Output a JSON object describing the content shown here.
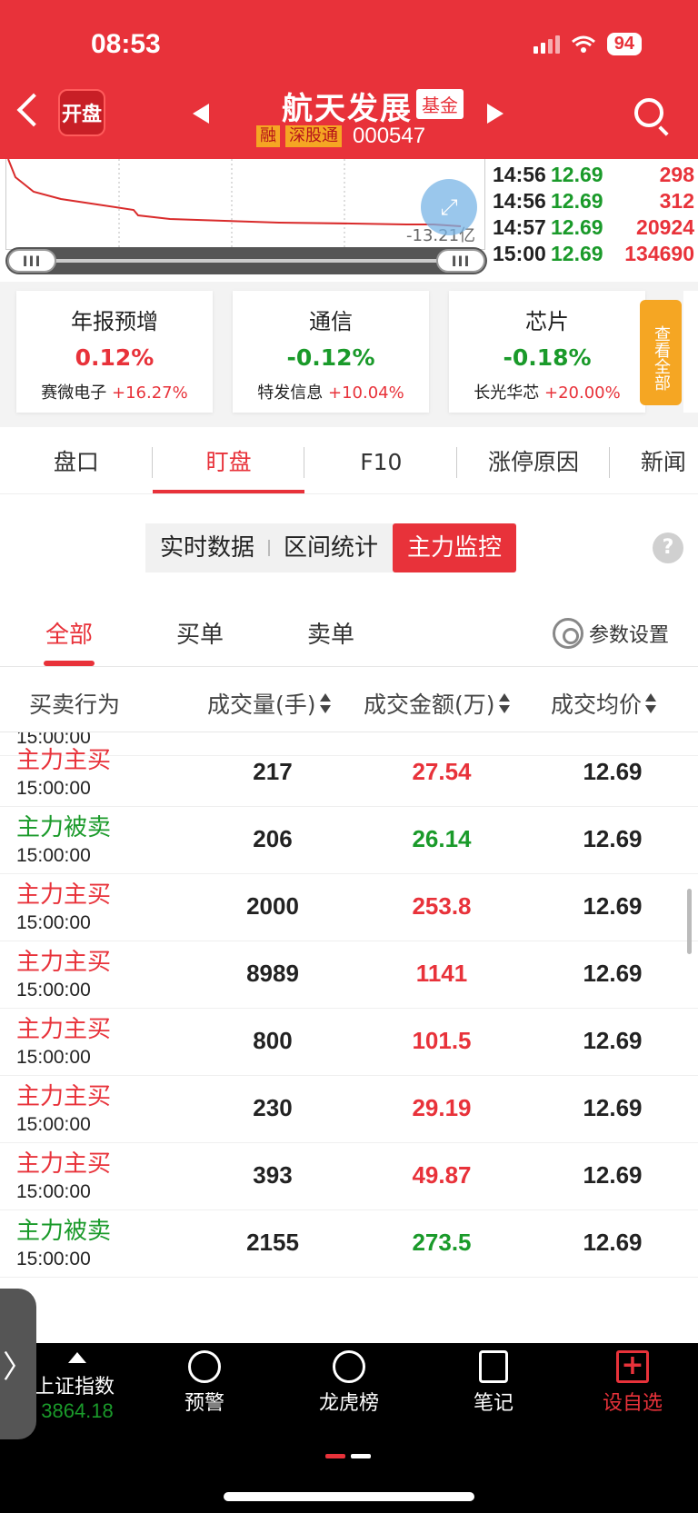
{
  "status": {
    "time": "08:53",
    "battery": "94"
  },
  "header": {
    "kaipan_label": "开盘",
    "title": "航天发展",
    "fund_tag": "基金",
    "tag_rong": "融",
    "tag_sgt": "深股通",
    "code": "000547"
  },
  "chart": {
    "label": "-13.21亿"
  },
  "ticks": [
    {
      "time": "14:56",
      "price": "12.69",
      "vol": "298"
    },
    {
      "time": "14:56",
      "price": "12.69",
      "vol": "312"
    },
    {
      "time": "14:57",
      "price": "12.69",
      "vol": "20924"
    },
    {
      "time": "15:00",
      "price": "12.69",
      "vol": "134690"
    }
  ],
  "sectors": [
    {
      "name": "年报预增",
      "pct": "0.12%",
      "leader": "赛微电子",
      "leader_pct": "+16.27%",
      "dir": "up"
    },
    {
      "name": "通信",
      "pct": "-0.12%",
      "leader": "特发信息",
      "leader_pct": "+10.04%",
      "dir": "down"
    },
    {
      "name": "芯片",
      "pct": "-0.18%",
      "leader": "长光华芯",
      "leader_pct": "+20.00%",
      "dir": "down"
    }
  ],
  "view_all": "查看全部",
  "tabs": [
    "盘口",
    "盯盘",
    "F10",
    "涨停原因",
    "新闻"
  ],
  "segments": [
    "实时数据",
    "区间统计",
    "主力监控"
  ],
  "help": "?",
  "subtabs": [
    "全部",
    "买单",
    "卖单"
  ],
  "settings_label": "参数设置",
  "columns": [
    "买卖行为",
    "成交量(手)",
    "成交金额(万)",
    "成交均价"
  ],
  "top_partial_time": "15:00:00",
  "rows": [
    {
      "action": "主力主买",
      "time": "15:00:00",
      "vol": "217",
      "amt": "27.54",
      "avg": "12.69",
      "side": "buy"
    },
    {
      "action": "主力被卖",
      "time": "15:00:00",
      "vol": "206",
      "amt": "26.14",
      "avg": "12.69",
      "side": "sell"
    },
    {
      "action": "主力主买",
      "time": "15:00:00",
      "vol": "2000",
      "amt": "253.8",
      "avg": "12.69",
      "side": "buy"
    },
    {
      "action": "主力主买",
      "time": "15:00:00",
      "vol": "8989",
      "amt": "1141",
      "avg": "12.69",
      "side": "buy"
    },
    {
      "action": "主力主买",
      "time": "15:00:00",
      "vol": "800",
      "amt": "101.5",
      "avg": "12.69",
      "side": "buy"
    },
    {
      "action": "主力主买",
      "time": "15:00:00",
      "vol": "230",
      "amt": "29.19",
      "avg": "12.69",
      "side": "buy"
    },
    {
      "action": "主力主买",
      "time": "15:00:00",
      "vol": "393",
      "amt": "49.87",
      "avg": "12.69",
      "side": "buy"
    },
    {
      "action": "主力被卖",
      "time": "15:00:00",
      "vol": "2155",
      "amt": "273.5",
      "avg": "12.69",
      "side": "sell"
    }
  ],
  "bottom_nav": {
    "index_name": "上证指数",
    "index_value": "3864.18",
    "items": [
      "预警",
      "龙虎榜",
      "笔记",
      "设自选"
    ]
  },
  "colors": {
    "brand": "#e8323a",
    "up": "#e8323a",
    "down": "#1a9a2a",
    "accent": "#f5a623"
  }
}
